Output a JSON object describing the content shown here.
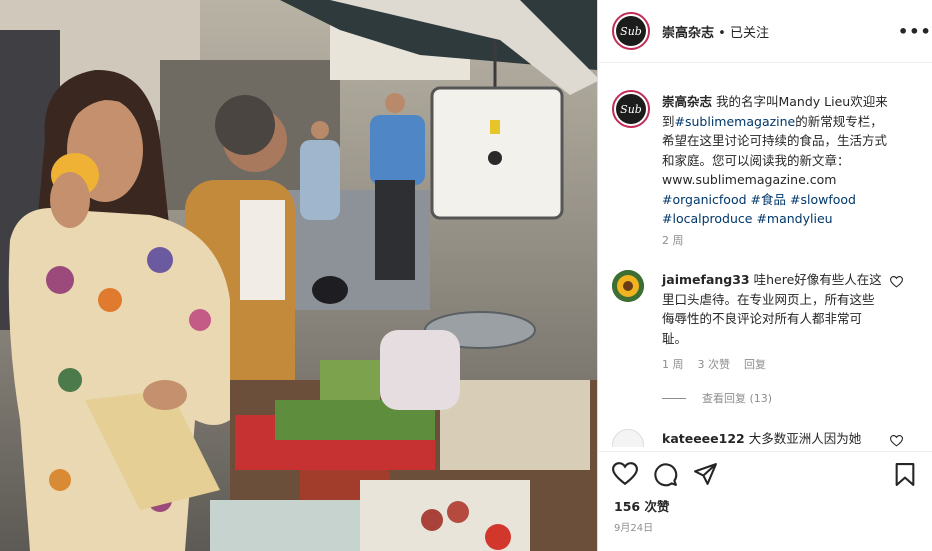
{
  "header": {
    "avatar_text": "Sub",
    "username": "崇高杂志",
    "separator": " • ",
    "follow_status": "已关注",
    "more_label": "•••"
  },
  "caption": {
    "avatar_text": "Sub",
    "username": "崇高杂志",
    "text_before": " 我的名字叫Mandy Lieu欢迎来到",
    "hashtag_main": "#sublimemagazine",
    "text_after": "的新常规专栏，希望在这里讨论可持续的食品，生活方式和家庭。您可以阅读我的新文章：www.sublimemagazine.com ",
    "tags": [
      "#organicfood",
      "#食品",
      "#slowfood",
      "#localproduce",
      "#mandylieu"
    ],
    "time_ago": "2 周"
  },
  "comments": [
    {
      "username": "jaimefang33",
      "text": " 哇here好像有些人在这里口头虐待。在专业网页上，所有这些侮辱性的不良评论对所有人都非常可耻。",
      "time": "1 周",
      "likes": "3 次赞",
      "reply_label": "回复",
      "view_replies": "查看回复 (13)"
    },
    {
      "username": "kateeee122",
      "text": " 大多数亚洲人因为她"
    }
  ],
  "actions": {
    "likes": "156 次赞",
    "date": "9月24日"
  },
  "icons": {
    "like": "heart-icon",
    "comment": "comment-icon",
    "share": "send-icon",
    "save": "bookmark-icon",
    "more": "more-icon"
  },
  "colors": {
    "avatar_ring": "#c22d57",
    "link": "#00376b",
    "muted": "#8e8e8e"
  }
}
